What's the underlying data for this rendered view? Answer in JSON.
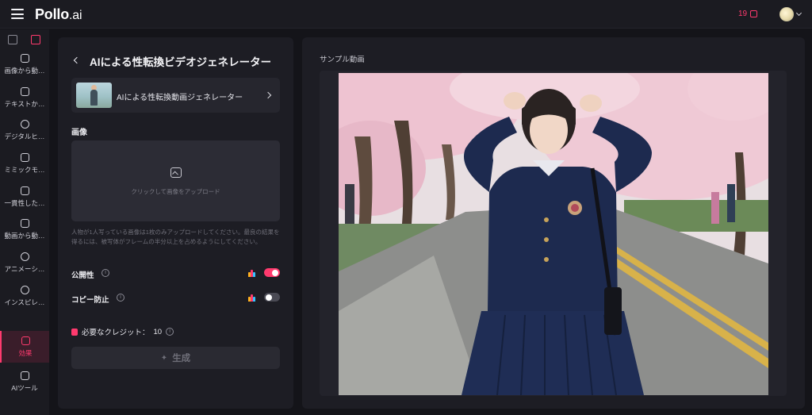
{
  "topbar": {
    "logo_main": "Pollo",
    "logo_suffix": ".ai",
    "credits": "19",
    "icons": [
      "menu-icon",
      "coin-icon",
      "avatar",
      "chevron-down-icon"
    ]
  },
  "sidebar": {
    "tabs": [
      "image-tab-icon",
      "video-tab-icon"
    ],
    "items": [
      {
        "label": "画像から動…",
        "icon": "image-to-video-icon"
      },
      {
        "label": "テキストか…",
        "icon": "text-to-video-icon"
      },
      {
        "label": "デジタルヒ…",
        "icon": "digital-human-icon"
      },
      {
        "label": "ミミックモ…",
        "icon": "mimic-motion-icon"
      },
      {
        "label": "一貫性した…",
        "icon": "consistent-icon"
      },
      {
        "label": "動画から動…",
        "icon": "video-to-video-icon"
      },
      {
        "label": "アニメーシ…",
        "icon": "animation-icon"
      },
      {
        "label": "インスピレ…",
        "icon": "compass-icon"
      },
      {
        "label": "効果",
        "icon": "effects-icon",
        "active": true
      },
      {
        "label": "AIツール",
        "icon": "ai-tools-icon"
      }
    ]
  },
  "left_panel": {
    "title": "AIによる性転換ビデオジェネレーター",
    "selector_label": "AIによる性転換動画ジェネレーター",
    "image_label": "画像",
    "upload_text": "クリックして画像をアップロード",
    "note": "人物が1人写っている画像は1枚のみアップロードしてください。最良の結果を得るには、被写体がフレームの半分以上を占めるようにしてください。",
    "public_label": "公開性",
    "public_on": true,
    "copy_protect_label": "コピー防止",
    "copy_protect_on": false,
    "credits_label": "必要なクレジット：",
    "credits_value": "10",
    "generate_label": "生成",
    "accent": "#ff3a6e"
  },
  "right_panel": {
    "sample_label": "サンプル動画"
  }
}
